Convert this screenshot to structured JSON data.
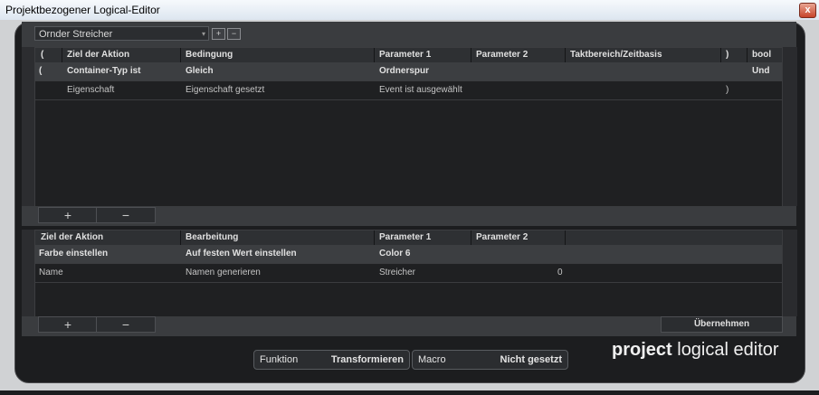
{
  "window": {
    "title": "Projektbezogener Logical-Editor",
    "close": "x"
  },
  "preset": {
    "value": "Ornder Streicher",
    "arrow": "▾"
  },
  "toolbar": {
    "store_icon": "+",
    "delete_icon": "−"
  },
  "filter": {
    "headers": [
      "(",
      "Ziel der Aktion",
      "Bedingung",
      "Parameter 1",
      "Parameter 2",
      "Taktbereich/Zeitbasis",
      ")",
      "bool"
    ],
    "rows": [
      {
        "open": "(",
        "target": "Container-Typ ist",
        "condition": "Gleich",
        "param1": "Ordnerspur",
        "param2": "",
        "range": "",
        "close": "",
        "bool": "Und"
      },
      {
        "open": "",
        "target": "Eigenschaft",
        "condition": "Eigenschaft gesetzt",
        "param1": "Event ist ausgewählt",
        "param2": "",
        "range": "",
        "close": ")",
        "bool": ""
      }
    ],
    "add": "+",
    "remove": "−"
  },
  "action": {
    "headers": [
      "Ziel der Aktion",
      "Bearbeitung",
      "Parameter 1",
      "Parameter 2"
    ],
    "rows": [
      {
        "target": "Farbe einstellen",
        "operation": "Auf festen Wert einstellen",
        "param1": "Color 6",
        "param2": ""
      },
      {
        "target": "Name",
        "operation": "Namen generieren",
        "param1": "Streicher",
        "param2": "0"
      }
    ],
    "add": "+",
    "remove": "−",
    "apply": "Übernehmen"
  },
  "function": {
    "label": "Funktion",
    "value": "Transformieren"
  },
  "macro": {
    "label": "Macro",
    "value": "Nicht gesetzt"
  },
  "logo": {
    "bold": "project",
    "rest": " logical editor"
  }
}
